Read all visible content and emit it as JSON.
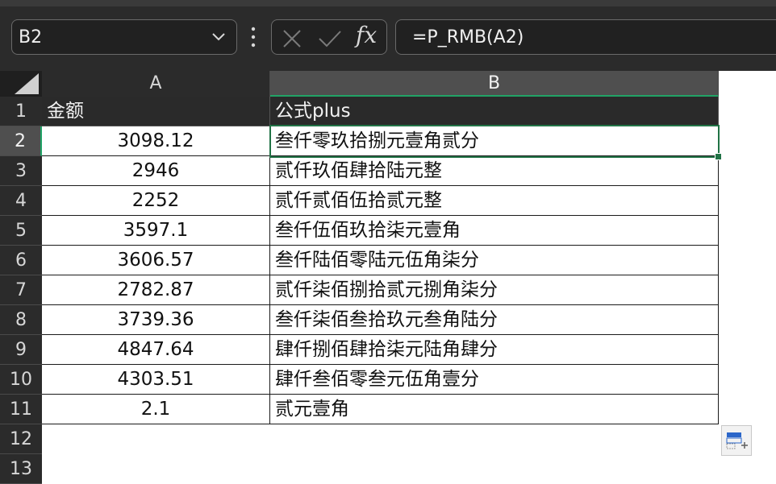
{
  "name_box": {
    "value": "B2"
  },
  "formula_bar": {
    "value": "=P_RMB(A2)",
    "fx_label": "fx"
  },
  "columns": [
    {
      "label": "A"
    },
    {
      "label": "B"
    }
  ],
  "row_numbers": [
    "1",
    "2",
    "3",
    "4",
    "5",
    "6",
    "7",
    "8",
    "9",
    "10",
    "11",
    "12",
    "13"
  ],
  "header_row": {
    "a": "金额",
    "b": "公式plus"
  },
  "rows": [
    {
      "a": "3098.12",
      "b": "叁仟零玖拾捌元壹角贰分"
    },
    {
      "a": "2946",
      "b": "贰仟玖佰肆拾陆元整"
    },
    {
      "a": "2252",
      "b": "贰仟贰佰伍拾贰元整"
    },
    {
      "a": "3597.1",
      "b": "叁仟伍佰玖拾柒元壹角"
    },
    {
      "a": "3606.57",
      "b": "叁仟陆佰零陆元伍角柒分"
    },
    {
      "a": "2782.87",
      "b": "贰仟柒佰捌拾贰元捌角柒分"
    },
    {
      "a": "3739.36",
      "b": "叁仟柒佰叁拾玖元叁角陆分"
    },
    {
      "a": "4847.64",
      "b": "肆仟捌佰肆拾柒元陆角肆分"
    },
    {
      "a": "4303.51",
      "b": "肆仟叁佰零叁元伍角壹分"
    },
    {
      "a": "2.1",
      "b": "贰元壹角"
    }
  ],
  "colors": {
    "selection": "#217346",
    "header_dark": "#2b2b2b"
  }
}
